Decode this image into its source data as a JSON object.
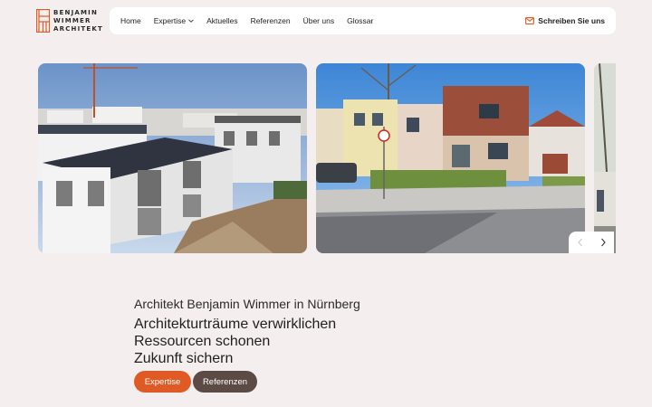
{
  "brand": {
    "line1": "BENJAMIN",
    "line2": "WIMMER",
    "line3": "ARCHITEKT",
    "color": "#e05a25"
  },
  "nav": {
    "items": [
      "Home",
      "Expertise",
      "Aktuelles",
      "Referenzen",
      "Über uns",
      "Glossar"
    ],
    "dropdown_item": "Expertise",
    "cta": "Schreiben Sie uns",
    "cta_icon": "mail-icon"
  },
  "carousel": {
    "slides": [
      "modern-housing-photo",
      "street-houses-photo",
      "partial-next-photo"
    ],
    "prev_icon": "chevron-left-icon",
    "next_icon": "chevron-right-icon"
  },
  "hero": {
    "subtitle": "Architekt Benjamin Wimmer in Nürnberg",
    "lines": [
      "Architekturträume verwirklichen",
      "Ressourcen schonen",
      "Zukunft sichern"
    ]
  },
  "buttons": {
    "primary": "Expertise",
    "secondary": "Referenzen"
  },
  "colors": {
    "background": "#f5eeee",
    "accent": "#e05a25",
    "secondary_button": "#5c4a44"
  }
}
